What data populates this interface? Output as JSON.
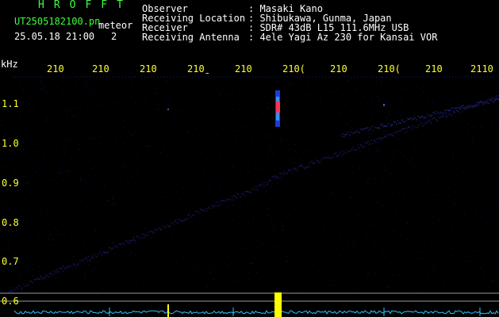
{
  "header": {
    "app_title": "HROFFT",
    "filename": "UT2505182100.pn",
    "meteor_label": "meteor",
    "datetime": "25.05.18 21:00",
    "meteor_count": "2"
  },
  "meta": [
    {
      "key": "Observer",
      "value": ": Masaki Kano"
    },
    {
      "key": "Receiving Location",
      "value": ": Shibukawa, Gunma, Japan"
    },
    {
      "key": "Receiver",
      "value": ": SDR# 43dB L15 111.6MHz USB"
    },
    {
      "key": "Receiving Antenna",
      "value": ": 4ele Yagi Az 230 for Kansai VOR"
    }
  ],
  "axis": {
    "y_unit": "kHz",
    "x_ticks": [
      "210",
      "210",
      "210",
      "210̱",
      "210",
      "210(",
      "210",
      "210(",
      "210",
      "2110"
    ],
    "y_ticks": [
      "1.1",
      "1.0",
      "0.9",
      "0.8",
      "0.7",
      "0.6"
    ]
  },
  "colors": {
    "background": "#000000",
    "label_green": "#3cff3c",
    "label_white": "#ffffff",
    "tick_yellow": "#ffff33",
    "trace_blue": "#2a2aa8",
    "echo_red": "#ff3050",
    "level_cyan": "#27c6ff",
    "peak_yellow": "#ffff00"
  }
}
